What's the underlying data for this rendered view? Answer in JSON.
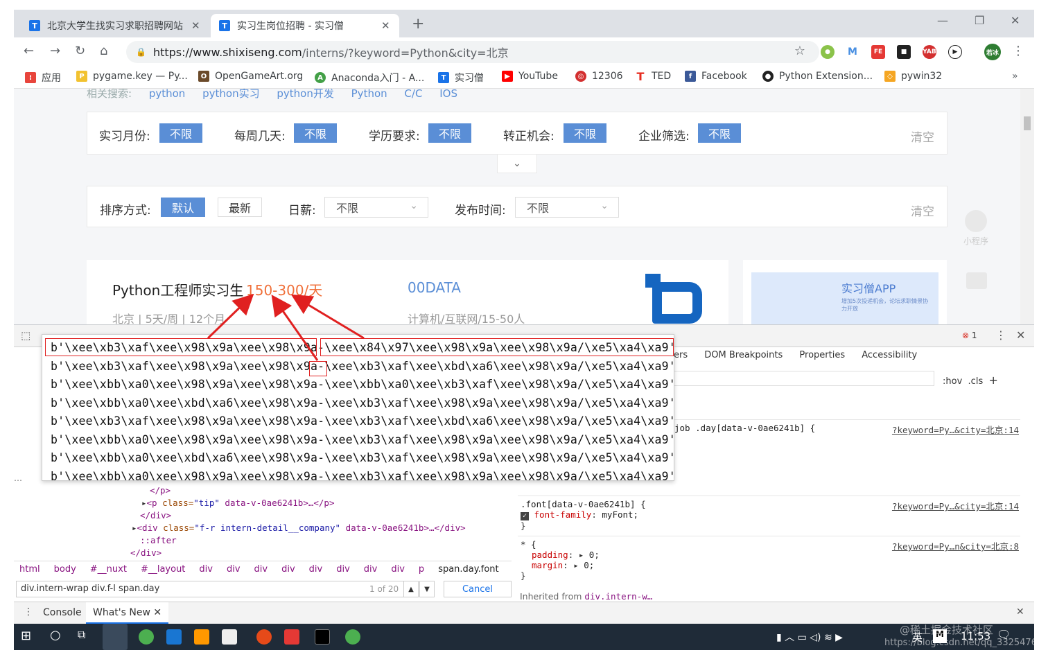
{
  "tabs": [
    {
      "title": "北京大学生找实习求职招聘网站",
      "active": false
    },
    {
      "title": "实习生岗位招聘 - 实习僧",
      "active": true
    }
  ],
  "address": {
    "host": "https://www.shixiseng.com",
    "path": "/interns/?keyword=Python&city=北京"
  },
  "profile_badge": "若冰",
  "bookmarks": [
    "应用",
    "pygame.key — Py...",
    "OpenGameArt.org",
    "Anaconda入门 - A...",
    "实习僧",
    "YouTube",
    "12306",
    "TED",
    "Facebook",
    "Python Extension...",
    "pywin32"
  ],
  "page": {
    "related_label": "相关搜索:",
    "related_keywords": [
      "python",
      "python实习",
      "python开发",
      "Python",
      "C/C",
      "IOS"
    ],
    "filters": [
      {
        "label": "实习月份:",
        "value": "不限"
      },
      {
        "label": "每周几天:",
        "value": "不限"
      },
      {
        "label": "学历要求:",
        "value": "不限"
      },
      {
        "label": "转正机会:",
        "value": "不限"
      },
      {
        "label": "企业筛选:",
        "value": "不限"
      }
    ],
    "clear_label": "清空",
    "sort_label": "排序方式:",
    "sort_default": "默认",
    "sort_newest": "最新",
    "salary_label": "日薪:",
    "salary_value": "不限",
    "publish_label": "发布时间:",
    "publish_value": "不限",
    "job": {
      "title": "Python工程师实习生",
      "salary": "150-300/天",
      "meta": "北京 | 5天/周 | 12个月",
      "company": "00DATA",
      "company_meta": "计算机/互联网/15-50人"
    },
    "app_title": "实习僧APP",
    "app_sub": "增加5次投递机会，论坛求职情景协力开放",
    "mini_program": "小程序"
  },
  "overlay_lines": [
    "b'\\xee\\xb3\\xaf\\xee\\x98\\x9a\\xee\\x98\\x9a-\\xee\\x84\\x97\\xee\\x98\\x9a\\xee\\x98\\x9a/\\xe5\\xa4\\xa9'",
    "b'\\xee\\xb3\\xaf\\xee\\x98\\x9a\\xee\\x98\\x9a-\\xee\\xb3\\xaf\\xee\\xbd\\xa6\\xee\\x98\\x9a/\\xe5\\xa4\\xa9'",
    "b'\\xee\\xbb\\xa0\\xee\\x98\\x9a\\xee\\x98\\x9a-\\xee\\xbb\\xa0\\xee\\xb3\\xaf\\xee\\x98\\x9a/\\xe5\\xa4\\xa9'",
    "b'\\xee\\xbb\\xa0\\xee\\xbd\\xa6\\xee\\x98\\x9a-\\xee\\xb3\\xaf\\xee\\x98\\x9a\\xee\\x98\\x9a/\\xe5\\xa4\\xa9'",
    "b'\\xee\\xb3\\xaf\\xee\\x98\\x9a\\xee\\x98\\x9a-\\xee\\xb3\\xaf\\xee\\xbd\\xa6\\xee\\x98\\x9a/\\xe5\\xa4\\xa9'",
    "b'\\xee\\xbb\\xa0\\xee\\x98\\x9a\\xee\\x98\\x9a-\\xee\\xb3\\xaf\\xee\\x98\\x9a\\xee\\x98\\x9a/\\xe5\\xa4\\xa9'",
    "b'\\xee\\xbb\\xa0\\xee\\xbd\\xa6\\xee\\x98\\x9a-\\xee\\xb3\\xaf\\xee\\x98\\x9a\\xee\\x98\\x9a/\\xe5\\xa4\\xa9'",
    "b'\\xee\\xbb\\xa0\\xee\\x98\\x9a\\xee\\x98\\x9a-\\xee\\xb3\\xaf\\xee\\x98\\x9a\\xee\\x98\\x9a/\\xe5\\xa4\\xa9'"
  ],
  "devtools": {
    "sidebar_tabs": [
      "ers",
      "DOM Breakpoints",
      "Properties",
      "Accessibility"
    ],
    "error_count": "1",
    "hov": ":hov",
    "cls": ".cls",
    "rules": [
      {
        "selector": "job .day[data-v-0ae6241b] {",
        "source": "?keyword=Py…&city=北京:14"
      },
      {
        "selector": ".font[data-v-0ae6241b] {",
        "source": "?keyword=Py…&city=北京:14",
        "prop": "font-family",
        "value": "myFont;"
      },
      {
        "selector": "* {",
        "source": "?keyword=Py…n&city=北京:8",
        "props": [
          [
            "padding",
            "0;"
          ],
          [
            "margin",
            "0;"
          ]
        ]
      }
    ],
    "inherited": "Inherited from",
    "inherited_from": "div.intern-w…",
    "dom": {
      "p_close": "</p>",
      "p_tip_tag": "<p ",
      "p_tip_attr": "class=",
      "p_tip_val": "\"tip\"",
      "p_tip_rest": " data-v-0ae6241b>…</p>",
      "div_close": "</div>",
      "div_company_tag": "<div ",
      "div_company_attr": "class=",
      "div_company_val": "\"f-r intern-detail__company\"",
      "div_company_rest": " data-v-0ae6241b>…</div>",
      "after": "::after",
      "div_close2": "</div>"
    },
    "breadcrumbs": [
      "html",
      "body",
      "#__nuxt",
      "#__layout",
      "div",
      "div",
      "div",
      "div",
      "div",
      "div",
      "div",
      "div",
      "p",
      "span.day.font"
    ],
    "search_value": "div.intern-wrap div.f-l span.day",
    "search_count": "1 of 20",
    "cancel": "Cancel",
    "drawer_tabs": [
      "Console",
      "What's New"
    ]
  },
  "taskbar": {
    "ime": "英",
    "time": "11:53",
    "watermark": "@稀土掘金技术社区",
    "url_watermark": "https://blog.csdn.net/qq_3325476"
  }
}
